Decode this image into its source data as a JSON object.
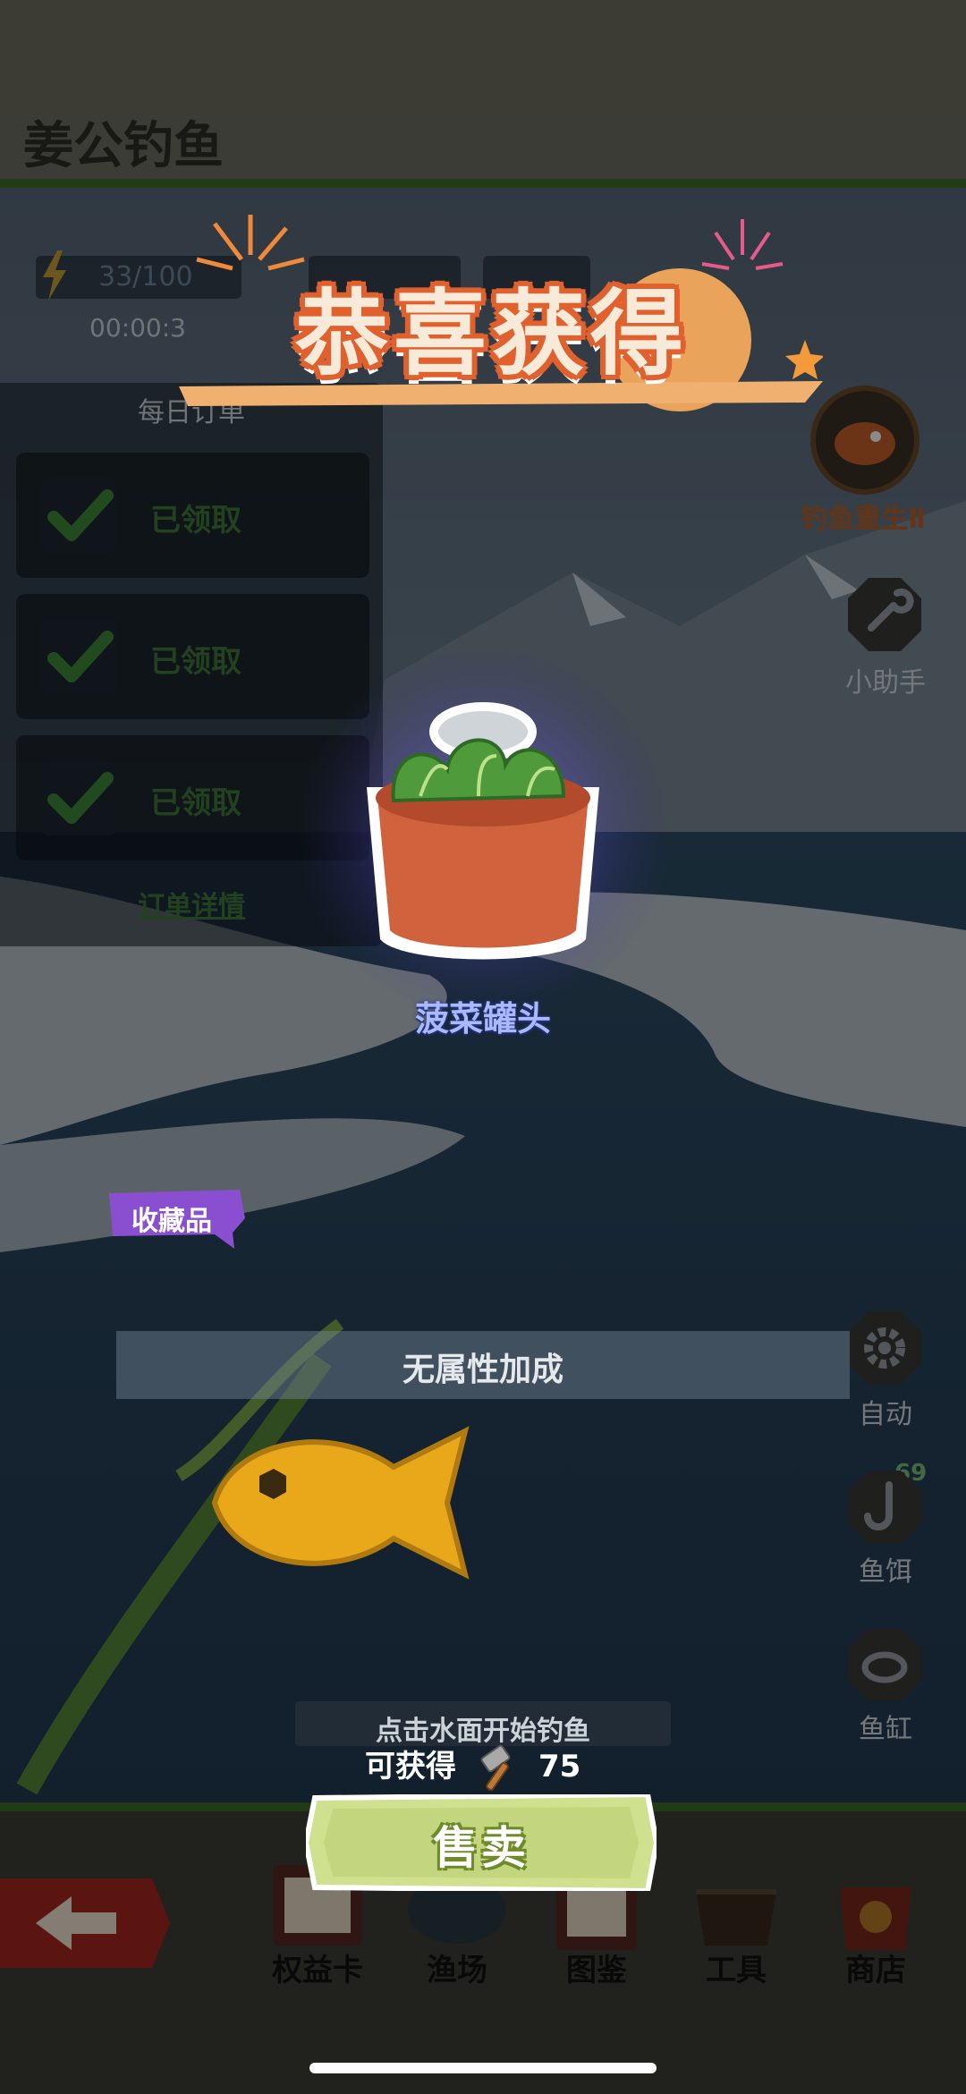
{
  "header": {
    "title": "姜公钓鱼"
  },
  "stats": {
    "energy": "33/100",
    "timer": "00:00:3"
  },
  "orders": {
    "title": "每日订单",
    "items": [
      {
        "status": "已领取"
      },
      {
        "status": "已领取"
      },
      {
        "status": "已领取"
      }
    ],
    "detail_link": "订单详情"
  },
  "right_menu": {
    "rebirth": "钓鱼重生Ⅱ",
    "helper": "小助手",
    "auto": "自动",
    "bait": "鱼饵",
    "bait_count": "69",
    "fish_tank": "鱼缸"
  },
  "bottom_nav": {
    "items": [
      {
        "label": "权益卡"
      },
      {
        "label": "渔场"
      },
      {
        "label": "图鉴"
      },
      {
        "label": "工具"
      },
      {
        "label": "商店"
      }
    ]
  },
  "reward_popup": {
    "title": "恭喜获得",
    "item_name": "菠菜罐头",
    "tag": "收藏品",
    "attribute": "无属性加成",
    "hint": "点击水面开始钓鱼",
    "gain_label": "可获得",
    "gain_value": "75",
    "sell_button": "售卖",
    "gain_icon": "hammer-icon"
  },
  "colors": {
    "sell_button": "#c9d98a",
    "banner_text_outline": "#e0602e",
    "tag": "#8a4fd0",
    "item_name": "#a9b8ff"
  }
}
